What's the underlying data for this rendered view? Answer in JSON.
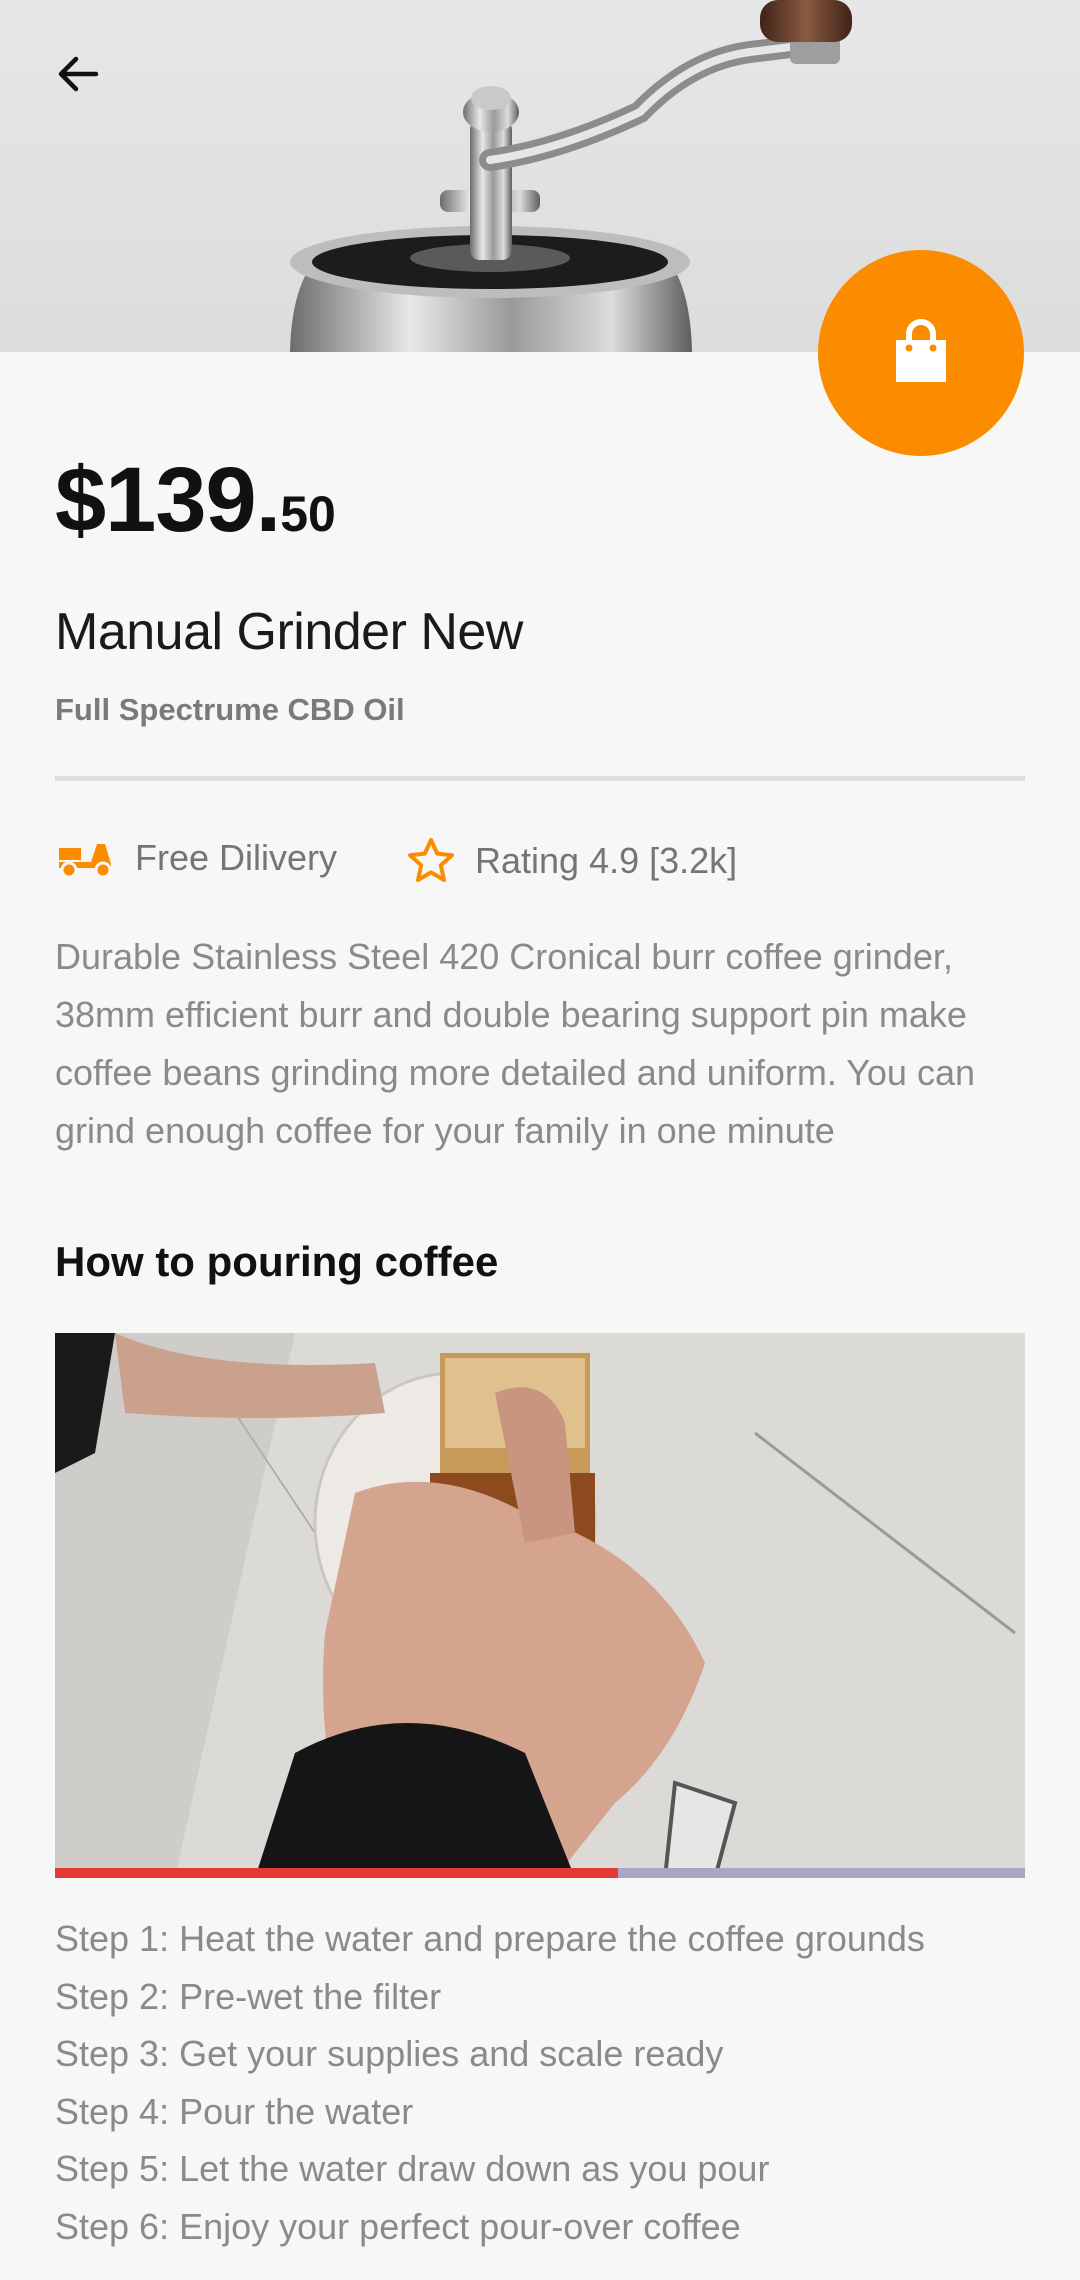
{
  "header": {
    "back_icon": "arrow-left-icon"
  },
  "actions": {
    "cart_icon": "shopping-bag-icon",
    "accent_color": "#fb8c00"
  },
  "product": {
    "price_main": "$139.",
    "price_cents": "50",
    "title": "Manual Grinder New",
    "subtitle": "Full Spectrume CBD Oil"
  },
  "features": [
    {
      "icon": "delivery-scooter-icon",
      "label": "Free Dilivery"
    },
    {
      "icon": "star-outline-icon",
      "label": "Rating 4.9 [3.2k]"
    }
  ],
  "description": "Durable Stainless Steel 420 Cronical burr coffee grinder, 38mm efficient burr and double bearing support pin make coffee beans grinding more detailed and uniform. You can grind enough coffee for your family in one minute",
  "how_to": {
    "title": "How to pouring coffee",
    "video_progress": 0.58,
    "steps": [
      "Step 1: Heat the water and prepare the coffee grounds",
      "Step 2: Pre-wet the filter",
      "Step 3: Get your supplies and scale ready",
      "Step 4: Pour the water",
      "Step 5: Let the water draw down as you pour",
      "Step 6: Enjoy your perfect pour-over coffee"
    ]
  }
}
